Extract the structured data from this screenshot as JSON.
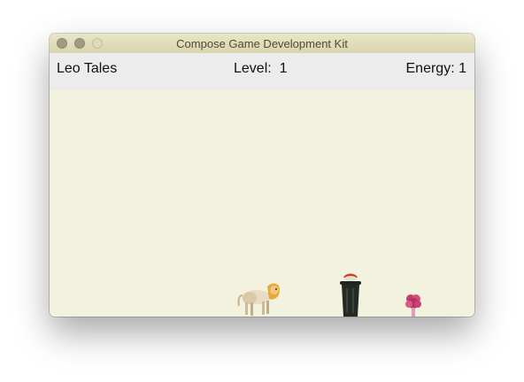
{
  "window": {
    "title": "Compose Game Development Kit"
  },
  "hud": {
    "game_title": "Leo Tales",
    "level_label": "Level:",
    "level_value": "1",
    "energy_label": "Energy:",
    "energy_value": "1"
  },
  "sprites": {
    "player": "lion-cub-sprite",
    "obstacle": "trash-can-sprite",
    "item": "flower-pickup-sprite"
  },
  "colors": {
    "field_background": "#f2f2df",
    "hud_background": "#ececec",
    "titlebar": "#ddd9b6"
  }
}
